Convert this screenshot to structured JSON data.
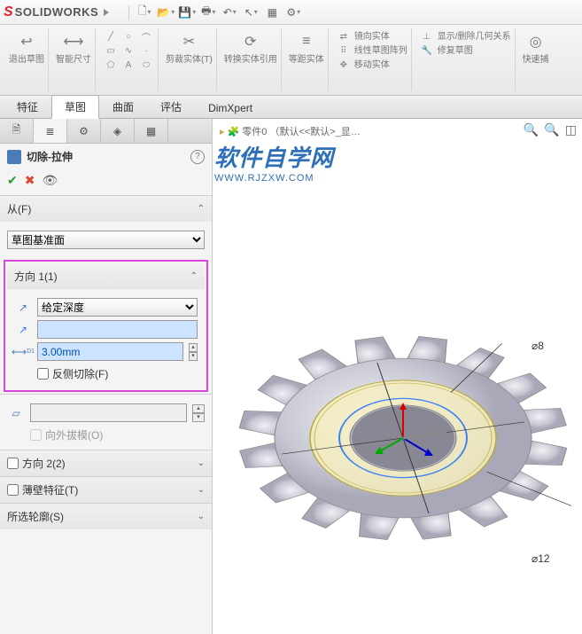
{
  "app": {
    "brand_s": "S",
    "brand_text": "SOLIDWORKS"
  },
  "ribbon": {
    "groups": [
      {
        "label": "退出草图"
      },
      {
        "label": "智能尺寸"
      },
      {
        "label": ""
      },
      {
        "label": "剪裁实体(T)"
      },
      {
        "label": "转换实体引用"
      },
      {
        "label": "等距实体"
      },
      {
        "label_a": "镜向实体",
        "label_b": "线性草图阵列",
        "label_c": "移动实体"
      },
      {
        "label_a": "显示/删除几何关系",
        "label_b": "修复草图"
      },
      {
        "label": "快速捕"
      }
    ]
  },
  "tabs": [
    "特征",
    "草图",
    "曲面",
    "评估",
    "DimXpert"
  ],
  "active_tab": 1,
  "feature": {
    "title": "切除-拉伸",
    "from_label": "从(F)",
    "from_value": "草图基准面",
    "dir1_label": "方向 1(1)",
    "dir1_type": "给定深度",
    "dir1_offset": "",
    "dir1_depth": "3.00mm",
    "reverse_label": "反侧切除(F)",
    "draft_label": "向外拔模(O)",
    "dir2_label": "方向 2(2)",
    "thin_label": "薄壁特征(T)",
    "contour_label": "所选轮廓(S)"
  },
  "viewport": {
    "crumb": "零件0 （默认<<默认>_显…",
    "watermark_title": "软件自学网",
    "watermark_url": "WWW.RJZXW.COM",
    "dim1": "⌀8",
    "dim2": "⌀12"
  }
}
